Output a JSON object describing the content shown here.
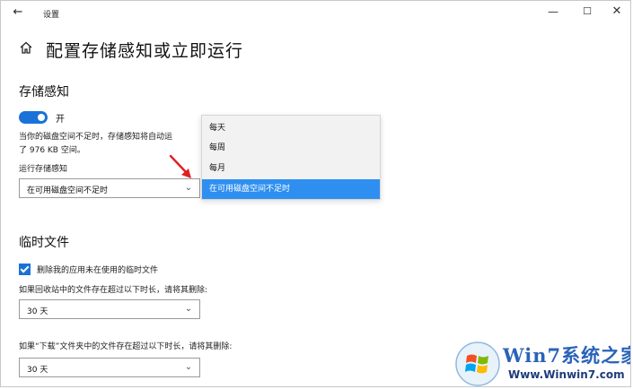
{
  "window": {
    "title": "设置",
    "back_glyph": "←",
    "minimize_glyph": "—",
    "maximize_glyph": "☐",
    "close_glyph": "✕"
  },
  "page": {
    "title": "配置存储感知或立即运行"
  },
  "storage_sense": {
    "heading": "存储感知",
    "toggle": {
      "state": "on",
      "label": "开"
    },
    "description_line1": "当你的磁盘空间不足时，存储感知将自动运",
    "description_line2": "了 976 KB 空间。",
    "run_label": "运行存储感知",
    "run_select": {
      "value": "在可用磁盘空间不足时",
      "options": [
        "每天",
        "每周",
        "每月",
        "在可用磁盘空间不足时"
      ],
      "selected_index": 3
    }
  },
  "temp_files": {
    "heading": "临时文件",
    "delete_checkbox": {
      "checked": true,
      "label": "删除我的应用未在使用的临时文件"
    },
    "recycle_label": "如果回收站中的文件存在超过以下时长，请将其删除:",
    "recycle_select": {
      "value": "30 天"
    },
    "downloads_label": "如果“下载”文件夹中的文件存在超过以下时长，请将其删除:",
    "downloads_select": {
      "value": "30 天"
    }
  },
  "watermark": {
    "title": "Win7系统之家",
    "url": "Www.Winwin7.com"
  },
  "colors": {
    "accent": "#1a72d8",
    "selected_option": "#2e8ff0",
    "annotation_arrow": "#e02020"
  },
  "icons": {
    "home": "home-icon",
    "back": "back-arrow-icon",
    "chevron": "chevron-down-icon",
    "annotation": "red-arrow-icon",
    "logo": "windows-logo-icon"
  }
}
